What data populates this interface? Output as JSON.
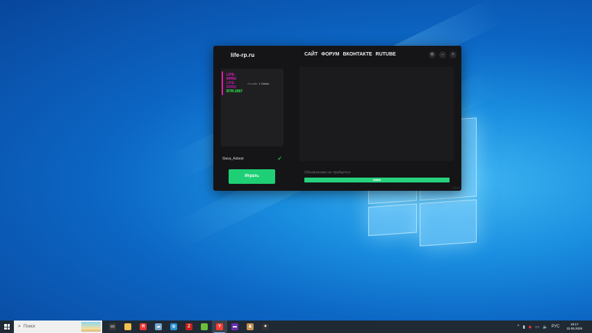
{
  "launcher": {
    "logo": "life-rp.ru",
    "nav": [
      "САЙТ",
      "ФОРУМ",
      "ВКОНТАКТЕ",
      "RUTUBE"
    ],
    "window_buttons": {
      "settings": "⚙",
      "minimize": "–",
      "close": "×"
    },
    "server": {
      "logo_lines": [
        "LIFE-RPRU",
        "LIFE-RPRU",
        "RTR:2057"
      ],
      "online_label": "Онлайн:",
      "online_value": "1 Online"
    },
    "user": {
      "name": "Slava_Asbest"
    },
    "play_label": "Играть",
    "status": "Обновление не требуется",
    "progress": {
      "percent": 100,
      "label": "100%"
    },
    "version": "1.0.0.0"
  },
  "taskbar": {
    "search_placeholder": "Поиск",
    "apps": [
      {
        "icon": "task-view-icon",
        "glyph": "▭",
        "color": "#3a3a3a"
      },
      {
        "icon": "file-explorer-icon",
        "glyph": "",
        "color": "#f2c14e"
      },
      {
        "icon": "yandex-icon",
        "glyph": "Я",
        "color": "#e33"
      },
      {
        "icon": "cloud-icon",
        "glyph": "☁",
        "color": "#7aa6cc"
      },
      {
        "icon": "app-icon",
        "glyph": "◎",
        "color": "#2b8fd6"
      },
      {
        "icon": "filezilla-icon",
        "glyph": "Z",
        "color": "#c8201e"
      },
      {
        "icon": "notepad-icon",
        "glyph": "",
        "color": "#6bbf3a"
      },
      {
        "icon": "yandex-browser-icon",
        "glyph": "Y",
        "color": "#ff3b30"
      },
      {
        "icon": "launcher-icon",
        "glyph": "▬",
        "color": "#6a2fb0"
      },
      {
        "icon": "game-icon",
        "glyph": "♟",
        "color": "#c89050"
      },
      {
        "icon": "rockstar-icon",
        "glyph": "✦",
        "color": "#333"
      }
    ],
    "tray": {
      "up": "^",
      "volume": "🔈",
      "language": "РУС",
      "time": "19:17",
      "date": "22.05.2025"
    }
  }
}
